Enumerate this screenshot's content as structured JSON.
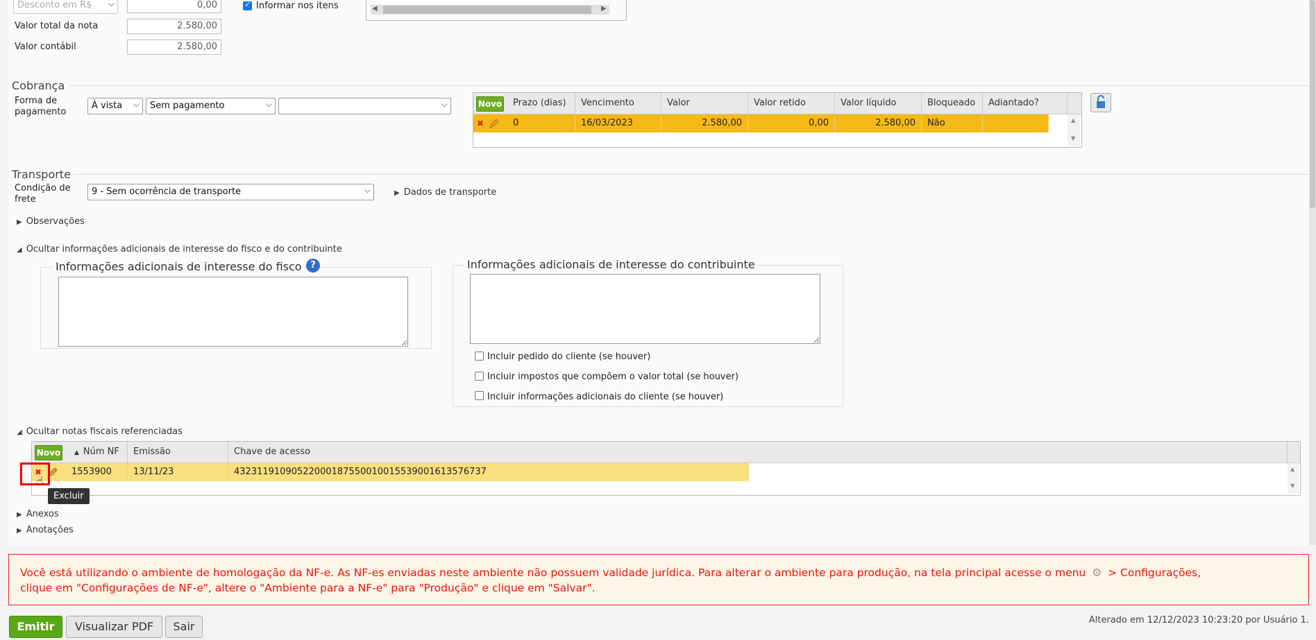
{
  "totals": {
    "discount_select": "Desconto em R$",
    "discount_value": "0,00",
    "inform_items_label": "Informar nos itens",
    "total_nota_label": "Valor total da nota",
    "total_nota_value": "2.580,00",
    "valor_contabil_label": "Valor contábil",
    "valor_contabil_value": "2.580,00"
  },
  "cobranca": {
    "title": "Cobrança",
    "forma_label": "Forma de pagamento",
    "select1": "À vista",
    "select2": "Sem pagamento",
    "select3": "",
    "novo_label": "Novo",
    "columns": [
      "Prazo (dias)",
      "Vencimento",
      "Valor",
      "Valor retido",
      "Valor líquido",
      "Bloqueado",
      "Adiantado?"
    ],
    "row": {
      "prazo": "0",
      "vencimento": "16/03/2023",
      "valor": "2.580,00",
      "retido": "0,00",
      "liquido": "2.580,00",
      "bloqueado": "Não",
      "adiantado": ""
    }
  },
  "transporte": {
    "title": "Transporte",
    "condicao_label": "Condição de frete",
    "condicao_value": "9 - Sem ocorrência de transporte",
    "dados_label": "Dados de transporte"
  },
  "observacoes_label": "Observações",
  "info_adicionais": {
    "toggle_label": "Ocultar informações adicionais de interesse do fisco e do contribuinte",
    "fisco_legend": "Informações adicionais de interesse do fisco",
    "contribuinte_legend": "Informações adicionais de interesse do contribuinte",
    "chk1": "Incluir pedido do cliente (se houver)",
    "chk2": "Incluir impostos que compõem o valor total (se houver)",
    "chk3": "Incluir informações adicionais do cliente (se houver)"
  },
  "notas_ref": {
    "toggle_label": "Ocultar notas fiscais referenciadas",
    "novo_label": "Novo",
    "columns": [
      "Núm NF",
      "Emissão",
      "Chave de acesso"
    ],
    "row": {
      "num": "1553900",
      "emissao": "13/11/23",
      "chave": "43231191090522000187550010015539001613576737"
    },
    "tooltip": "Excluir"
  },
  "anexos_label": "Anexos",
  "anotacoes_label": "Anotações",
  "warning": {
    "line1": "Você está utilizando o ambiente de homologação da NF-e. As NF-es enviadas neste ambiente não possuem validade jurídica. Para alterar o ambiente para produção, na tela principal acesse o menu",
    "line1b": "> Configurações,",
    "line2": "clique em \"Configurações de NF-e\", altere o \"Ambiente para a NF-e\" para \"Produção\" e clique em \"Salvar\"."
  },
  "buttons": {
    "emitir": "Emitir",
    "pdf": "Visualizar PDF",
    "sair": "Sair"
  },
  "footer": "Alterado em 12/12/2023 10:23:20 por Usuário 1."
}
